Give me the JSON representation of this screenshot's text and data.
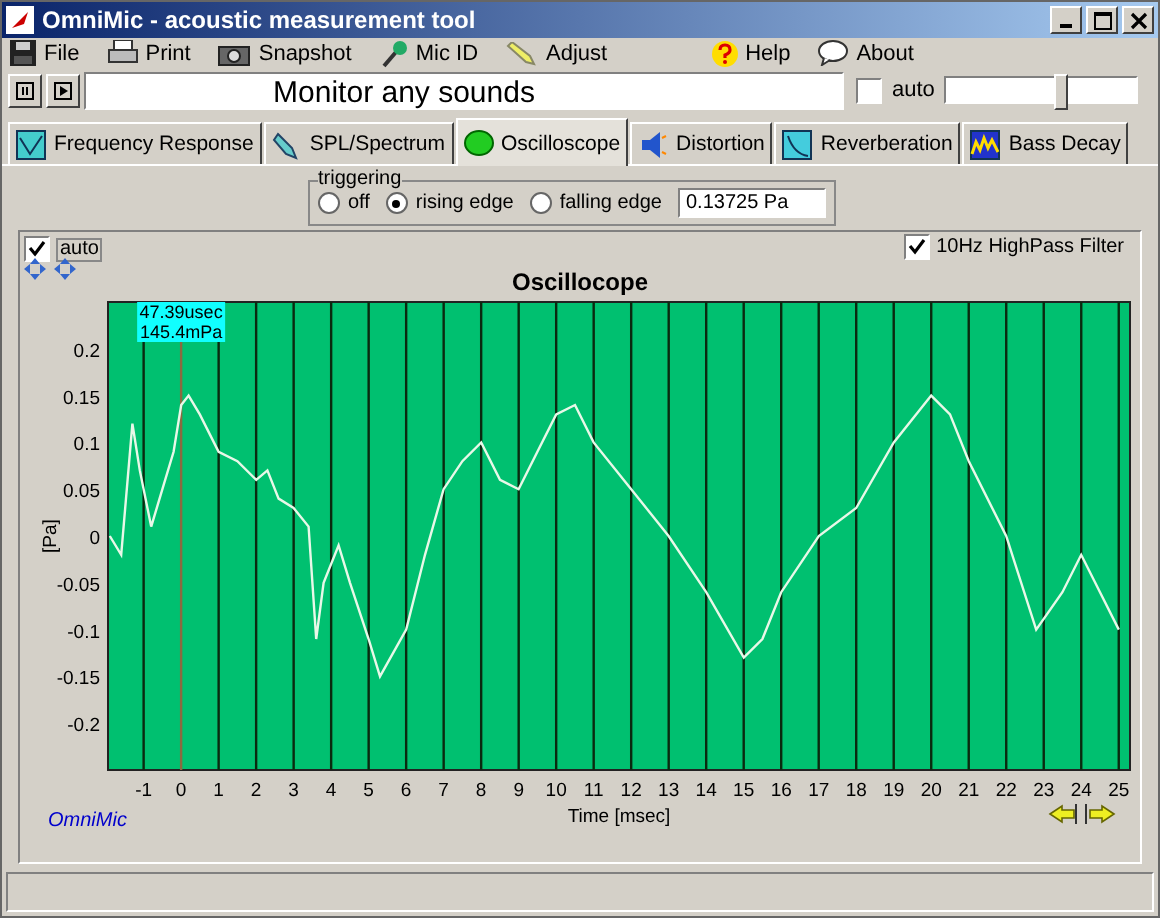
{
  "window": {
    "title": "OmniMic - acoustic measurement tool"
  },
  "menu": [
    {
      "label": "File",
      "kind": "disk"
    },
    {
      "label": "Print",
      "kind": "printer"
    },
    {
      "label": "Snapshot",
      "kind": "camera"
    },
    {
      "label": "Mic ID",
      "kind": "mic"
    },
    {
      "label": "Adjust",
      "kind": "pencil"
    },
    {
      "label": "Help",
      "kind": "question"
    },
    {
      "label": "About",
      "kind": "bubble"
    }
  ],
  "monitor": {
    "text": "Monitor any sounds",
    "auto": {
      "label": "auto",
      "checked": false
    },
    "level": 0.6
  },
  "tabs": [
    {
      "label": "Frequency Response",
      "selected": false
    },
    {
      "label": "SPL/Spectrum",
      "selected": false
    },
    {
      "label": "Oscilloscope",
      "selected": true
    },
    {
      "label": "Distortion",
      "selected": false
    },
    {
      "label": "Reverberation",
      "selected": false
    },
    {
      "label": "Bass Decay",
      "selected": false
    }
  ],
  "triggering": {
    "title": "triggering",
    "options": [
      {
        "label": "off",
        "selected": false
      },
      {
        "label": "rising edge",
        "selected": true
      },
      {
        "label": "falling edge",
        "selected": false
      }
    ],
    "value": "0.13725 Pa"
  },
  "panel": {
    "auto": {
      "label": "auto",
      "checked": true
    },
    "highpass": {
      "label": "10Hz HighPass Filter",
      "checked": true
    },
    "cursor": [
      "47.39usec",
      "145.4mPa"
    ],
    "brand": "OmniMic",
    "chart_data": {
      "type": "line",
      "title": "Oscillocope",
      "xlabel": "Time [msec]",
      "ylabel": "[Pa]",
      "xlim": [
        -1.95,
        25.3
      ],
      "ylim": [
        -0.25,
        0.25
      ],
      "xticks": [
        -1,
        0,
        1,
        2,
        3,
        4,
        5,
        6,
        7,
        8,
        9,
        10,
        11,
        12,
        13,
        14,
        15,
        16,
        17,
        18,
        19,
        20,
        21,
        22,
        23,
        24,
        25
      ],
      "yticks": [
        -0.2,
        -0.15,
        -0.1,
        -0.05,
        0,
        0.05,
        0.1,
        0.15,
        0.2
      ],
      "x": [
        -1.9,
        -1.6,
        -1.3,
        -1.1,
        -0.8,
        -0.5,
        -0.2,
        0,
        0.2,
        0.5,
        1,
        1.5,
        2,
        2.3,
        2.6,
        3,
        3.4,
        3.6,
        3.8,
        4.2,
        4.5,
        5,
        5.3,
        6,
        6.5,
        7,
        7.5,
        8,
        8.5,
        9,
        9.5,
        10,
        10.5,
        11,
        12,
        13,
        14,
        15,
        15.5,
        16,
        17,
        18,
        19,
        20,
        20.5,
        21,
        22,
        22.8,
        23.5,
        24,
        24.5,
        25
      ],
      "grid": true,
      "ref_lines": [
        {
          "axis": "x",
          "value": 0,
          "color": "#8a6a40"
        }
      ],
      "series": [
        {
          "color": "#e8f8e8",
          "values": [
            0,
            -0.02,
            0.12,
            0.07,
            0.01,
            0.05,
            0.09,
            0.14,
            0.15,
            0.13,
            0.09,
            0.08,
            0.06,
            0.07,
            0.04,
            0.03,
            0.01,
            -0.11,
            -0.05,
            -0.01,
            -0.05,
            -0.11,
            -0.15,
            -0.1,
            -0.02,
            0.05,
            0.08,
            0.1,
            0.06,
            0.05,
            0.09,
            0.13,
            0.14,
            0.1,
            0.05,
            0,
            -0.06,
            -0.13,
            -0.11,
            -0.06,
            0,
            0.03,
            0.1,
            0.15,
            0.13,
            0.08,
            0,
            -0.1,
            -0.06,
            -0.02,
            -0.06,
            -0.1
          ]
        }
      ]
    }
  }
}
